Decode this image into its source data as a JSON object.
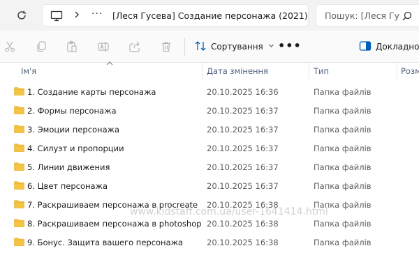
{
  "address_bar": {
    "breadcrumb_more": "···",
    "path_text": "[Леся Гусева] Создание персонажа (2021)",
    "search_placeholder": "Пошук: [Леся Гу"
  },
  "toolbar": {
    "sort_label": "Сортування",
    "more_label": "•••",
    "details_label": "Докладно"
  },
  "columns": {
    "name": "Ім'я",
    "date": "Дата змінення",
    "type": "Тип",
    "size": "Розм"
  },
  "files": [
    {
      "name": "1. Создание карты персонажа",
      "date": "20.10.2025 16:36",
      "type": "Папка файлів"
    },
    {
      "name": "2. Формы персонажа",
      "date": "20.10.2025 16:37",
      "type": "Папка файлів"
    },
    {
      "name": "3. Эмоции персонажа",
      "date": "20.10.2025 16:37",
      "type": "Папка файлів"
    },
    {
      "name": "4. Силуэт и пропорции",
      "date": "20.10.2025 16:37",
      "type": "Папка файлів"
    },
    {
      "name": "5. Линии движения",
      "date": "20.10.2025 16:37",
      "type": "Папка файлів"
    },
    {
      "name": "6. Цвет персонажа",
      "date": "20.10.2025 16:37",
      "type": "Папка файлів"
    },
    {
      "name": "7. Раскрашиваем персонажа в procreate",
      "date": "20.10.2025 16:38",
      "type": "Папка файлів"
    },
    {
      "name": "8. Раскрашиваем персонажа в photoshop",
      "date": "20.10.2025 16:38",
      "type": "Папка файлів"
    },
    {
      "name": "9. Бонус. Защита вашего персонажа",
      "date": "20.10.2025 16:38",
      "type": "Папка файлів"
    }
  ],
  "watermark": "www.kidstaff.com.ua/user-1641414.html",
  "colors": {
    "folder": "#f5c445",
    "header_text": "#4a5f7a",
    "accent": "#005fb8"
  }
}
